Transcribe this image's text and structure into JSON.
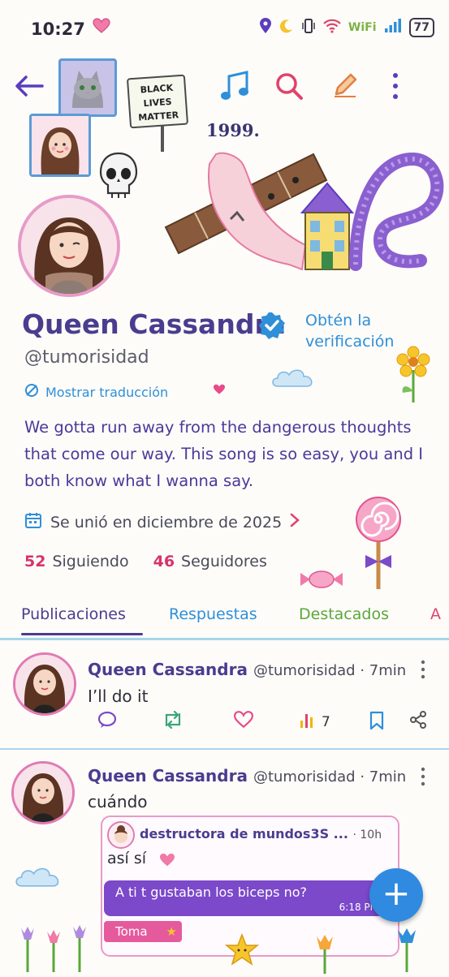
{
  "status_bar": {
    "time": "10:27",
    "wifi_label": "WiFi",
    "battery": "77"
  },
  "header": {
    "sign_lines": [
      "BLACK",
      "LIVES",
      "MATTER"
    ],
    "year": "1999."
  },
  "profile": {
    "name": "Queen Cassandra",
    "verify_cta_line1": "Obtén la",
    "verify_cta_line2": "verificación",
    "handle": "@tumorisidad",
    "translate_label": "Mostrar traducción",
    "bio": "We gotta run away from the dangerous thoughts that come our way. This song is so easy, you and I both know what I wanna say.",
    "joined": "Se unió en diciembre de 2025",
    "following_count": "52",
    "following_label": "Siguiendo",
    "followers_count": "46",
    "followers_label": "Seguidores"
  },
  "tabs": [
    {
      "label": "Publicaciones",
      "color": "#4a3d8f"
    },
    {
      "label": "Respuestas",
      "color": "#2f8fd9"
    },
    {
      "label": "Destacados",
      "color": "#5aa83a"
    },
    {
      "label": "A",
      "color": "#e0436b"
    }
  ],
  "posts": [
    {
      "name": "Queen Cassandra",
      "handle": "@tumorisidad · 7min",
      "text": "I’ll do it",
      "views": "7"
    },
    {
      "name": "Queen Cassandra",
      "handle": "@tumorisidad · 7min",
      "text": "cuándo",
      "quote": {
        "name": "destructora de mundos3S ...",
        "time": "· 10h",
        "text": "así sí",
        "bubble_text": "A ti t gustaban los biceps no?",
        "bubble_time": "6:18 PM",
        "tag": "Toma"
      }
    }
  ],
  "fab_label": "+",
  "colors": {
    "accent_purple": "#4a3d8f",
    "accent_blue": "#2f8fd9",
    "accent_pink": "#d6336c"
  }
}
